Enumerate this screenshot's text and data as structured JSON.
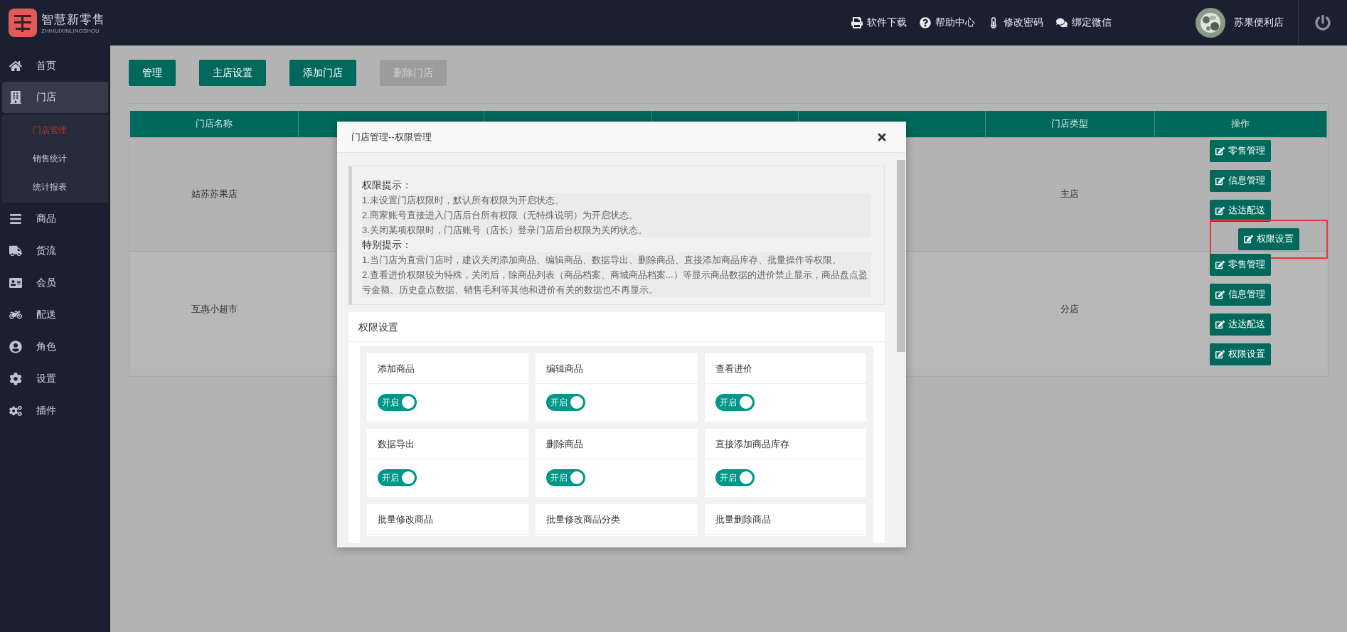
{
  "header": {
    "logo": {
      "title": "智慧新零售",
      "subtitle": "ZHIHUIXINLINGSHOU"
    },
    "links": [
      {
        "label": "软件下载"
      },
      {
        "label": "帮助中心"
      },
      {
        "label": "修改密码"
      },
      {
        "label": "绑定微信"
      }
    ],
    "user": {
      "name": "苏果便利店"
    }
  },
  "sidebar": {
    "items": [
      {
        "label": "首页",
        "selected": false
      },
      {
        "label": "门店",
        "selected": true,
        "expanded": true,
        "children": [
          {
            "label": "门店管理",
            "selected": true
          },
          {
            "label": "销售统计",
            "selected": false
          },
          {
            "label": "统计报表",
            "selected": false
          }
        ]
      },
      {
        "label": "商品",
        "selected": false
      },
      {
        "label": "货流",
        "selected": false
      },
      {
        "label": "会员",
        "selected": false
      },
      {
        "label": "配送",
        "selected": false
      },
      {
        "label": "角色",
        "selected": false
      },
      {
        "label": "设置",
        "selected": false
      },
      {
        "label": "插件",
        "selected": false
      }
    ]
  },
  "toolbar": {
    "buttons": [
      {
        "label": "管理",
        "disabled": false
      },
      {
        "label": "主店设置",
        "disabled": false
      },
      {
        "label": "添加门店",
        "disabled": false
      },
      {
        "label": "删除门店",
        "disabled": true
      }
    ]
  },
  "table": {
    "columns": [
      {
        "label": "门店名称"
      },
      {},
      {},
      {},
      {},
      {
        "label": "门店类型"
      },
      {
        "label": "操作"
      }
    ],
    "rows": [
      {
        "name": "姑苏苏果店",
        "type": "主店",
        "actions": [
          {
            "label": "零售管理",
            "highlighted": false
          },
          {
            "label": "信息管理",
            "highlighted": false
          },
          {
            "label": "达达配送",
            "highlighted": false
          },
          {
            "label": "权限设置",
            "highlighted": true
          }
        ]
      },
      {
        "name": "互惠小超市",
        "type": "分店",
        "actions": [
          {
            "label": "零售管理",
            "highlighted": false
          },
          {
            "label": "信息管理",
            "highlighted": false
          },
          {
            "label": "达达配送",
            "highlighted": false
          },
          {
            "label": "权限设置",
            "highlighted": false
          }
        ]
      }
    ]
  },
  "modal": {
    "title": "门店管理--权限管理",
    "notices": [
      {
        "heading": "权限提示：",
        "lines": [
          "1.未设置门店权限时，默认所有权限为开启状态。",
          "2.商家账号直接进入门店后台所有权限（无特殊说明）为开启状态。",
          "3.关闭某项权限时，门店账号（店长）登录门店后台权限为关闭状态。"
        ]
      },
      {
        "heading": "特别提示：",
        "lines": [
          "1.当门店为直营门店时，建议关闭添加商品、编辑商品、数据导出、删除商品、直接添加商品库存、批量操作等权限。",
          "2.查看进价权限较为特殊，关闭后，除商品列表（商品档案、商城商品档案...）等显示商品数据的进价禁止显示，商品盘点盈亏金额、历史盘点数据、销售毛利等其他和进价有关的数据也不再显示。"
        ]
      }
    ],
    "settings_title": "权限设置",
    "permissions": [
      {
        "label": "添加商品",
        "on": true,
        "switch_label": "开启"
      },
      {
        "label": "编辑商品",
        "on": true,
        "switch_label": "开启"
      },
      {
        "label": "查看进价",
        "on": true,
        "switch_label": "开启"
      },
      {
        "label": "数据导出",
        "on": true,
        "switch_label": "开启"
      },
      {
        "label": "删除商品",
        "on": true,
        "switch_label": "开启"
      },
      {
        "label": "直接添加商品库存",
        "on": true,
        "switch_label": "开启"
      },
      {
        "label": "批量修改商品"
      },
      {
        "label": "批量修改商品分类"
      },
      {
        "label": "批量删除商品"
      }
    ]
  }
}
